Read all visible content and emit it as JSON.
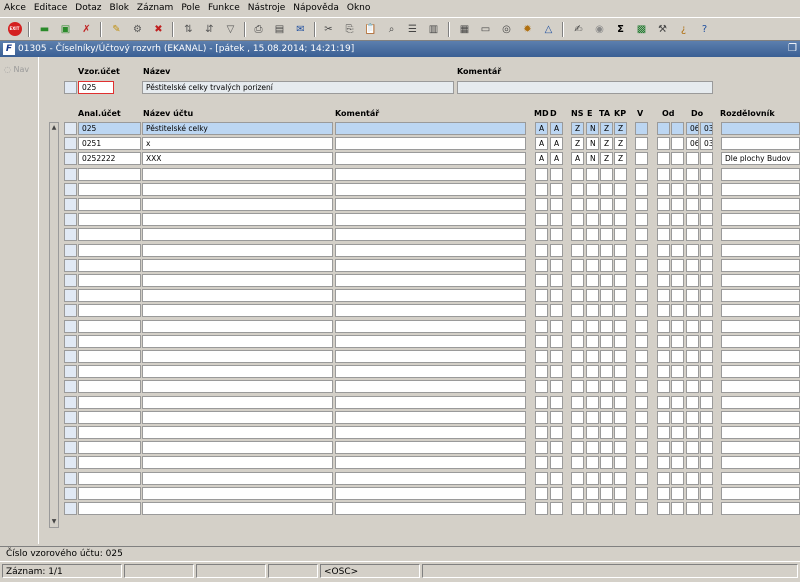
{
  "menu": [
    "Akce",
    "Editace",
    "Dotaz",
    "Blok",
    "Záznam",
    "Pole",
    "Funkce",
    "Nástroje",
    "Nápověda",
    "Okno"
  ],
  "toolbar": {
    "exit_label": "EXIT"
  },
  "window": {
    "title": "01305 - Číselníky/Účtový rozvrh (EKANAL) - [pátek  , 15.08.2014; 14:21:19]",
    "app_icon": "F"
  },
  "nav": {
    "label": "Nav"
  },
  "header": {
    "vzor_label": "Vzor.účet",
    "vzor_value": "025",
    "nazev_label": "Název",
    "nazev_value": "Pěstitelské celky trvalých porizení",
    "komentar_label": "Komentář",
    "komentar_value": ""
  },
  "columns": [
    "Anal.účet",
    "Název účtu",
    "Komentář",
    "MD",
    "D",
    "NS",
    "E",
    "TA",
    "KP",
    "V",
    "Od",
    "Do",
    "Rozdělovník"
  ],
  "rows": [
    {
      "ucet": "025",
      "nazev": "Pěstitelské celky",
      "koment": "",
      "md": "A",
      "d": "A",
      "ns": "Z",
      "e": "N",
      "ta": "Z",
      "kp": "Z",
      "v": "",
      "od": "",
      "od2": "",
      "do": "06",
      "do2": "03",
      "rozd": ""
    },
    {
      "ucet": "0251",
      "nazev": "x",
      "koment": "",
      "md": "A",
      "d": "A",
      "ns": "Z",
      "e": "N",
      "ta": "Z",
      "kp": "Z",
      "v": "",
      "od": "",
      "od2": "",
      "do": "06",
      "do2": "03",
      "rozd": ""
    },
    {
      "ucet": "0252222",
      "nazev": "XXX",
      "koment": "",
      "md": "A",
      "d": "A",
      "ns": "A",
      "e": "N",
      "ta": "Z",
      "kp": "Z",
      "v": "",
      "od": "",
      "od2": "",
      "do": "",
      "do2": "",
      "rozd": "Dle plochy Budov"
    }
  ],
  "total_rows": 26,
  "status": {
    "line1": "Číslo vzorového účtu: 025",
    "record": "Záznam: 1/1",
    "mode": "<OSC>"
  },
  "colors": {
    "selected_row": "#bcd6f2",
    "title_bar": "#3a5f94",
    "highlight_border": "#e03030"
  }
}
